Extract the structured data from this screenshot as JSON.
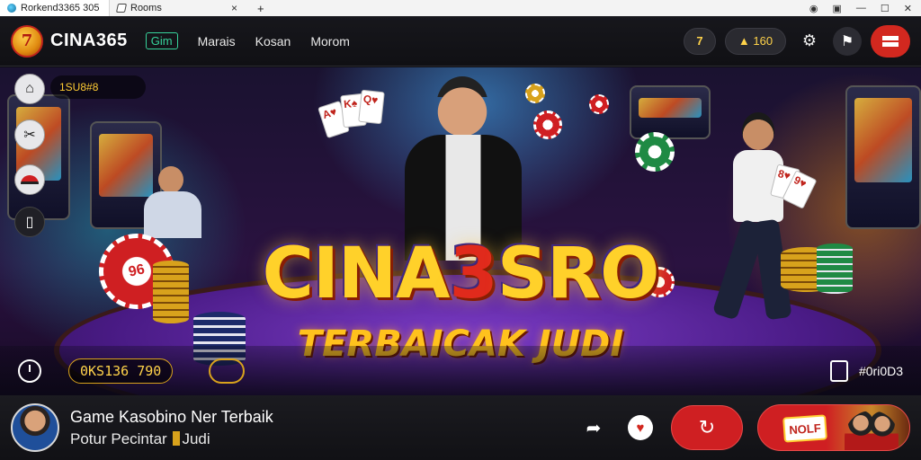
{
  "browser": {
    "tabs": [
      {
        "title": "Rorkend3365 305",
        "active": true
      },
      {
        "title": "Rooms",
        "active": false
      }
    ],
    "tab_close": "×",
    "new_tab": "+"
  },
  "header": {
    "brand": "CINA365",
    "logo_glyph": "7",
    "nav": [
      "Gim",
      "Marais",
      "Kosan",
      "Morom"
    ],
    "pill_icon_glyph": "7",
    "balance": "▲ 160",
    "accent_color": "#d2281f"
  },
  "sidebar": {
    "label": "1SU8#8",
    "icons": [
      "home-icon",
      "tools-icon",
      "hat-icon",
      "phone-icon"
    ]
  },
  "hero": {
    "title_a": "CINA",
    "title_mid": "3",
    "title_b": "SRO",
    "subtitle": "TERBAICAK JUDI",
    "chip_text": "96",
    "timer": "0KS136 790",
    "tab_label": "#0ri0D3"
  },
  "footer": {
    "line1": "Game Kasobino Ner Terbaik",
    "line2_a": "Potur Pecintar",
    "line2_b": "Judi",
    "promo_label": "NOLF"
  }
}
